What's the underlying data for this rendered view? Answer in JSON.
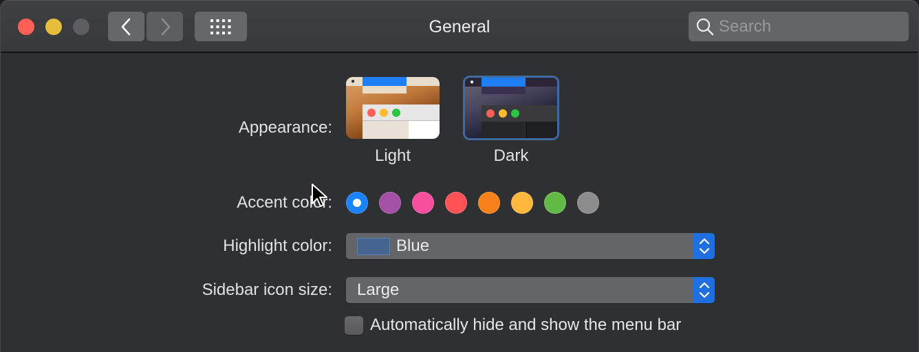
{
  "window": {
    "title": "General",
    "traffic_lights": {
      "close_color": "#fe5f57",
      "minimize_color": "#e5bf3c",
      "zoom_color": "#5e5e60"
    }
  },
  "toolbar": {
    "back_icon": "chevron-left-icon",
    "forward_icon": "chevron-right-icon",
    "grid_icon": "show-all-grid-icon",
    "search": {
      "placeholder": "Search",
      "value": "",
      "icon": "search-icon"
    }
  },
  "appearance": {
    "label": "Appearance:",
    "options": [
      {
        "label": "Light",
        "selected": false
      },
      {
        "label": "Dark",
        "selected": true
      }
    ]
  },
  "accent_color": {
    "label": "Accent color:",
    "options": [
      {
        "name": "Blue",
        "color": "#1a82fb",
        "selected": true
      },
      {
        "name": "Purple",
        "color": "#a550a7",
        "selected": false
      },
      {
        "name": "Pink",
        "color": "#f74f9e",
        "selected": false
      },
      {
        "name": "Red",
        "color": "#fe5257",
        "selected": false
      },
      {
        "name": "Orange",
        "color": "#f7821b",
        "selected": false
      },
      {
        "name": "Yellow",
        "color": "#ffb73d",
        "selected": false
      },
      {
        "name": "Green",
        "color": "#62ba46",
        "selected": false
      },
      {
        "name": "Graphite",
        "color": "#8c8c8c",
        "selected": false
      }
    ]
  },
  "highlight_color": {
    "label": "Highlight color:",
    "value": "Blue",
    "swatch_color": "#44658f"
  },
  "sidebar_icon_size": {
    "label": "Sidebar icon size:",
    "value": "Large"
  },
  "menu_bar": {
    "label": "Automatically hide and show the menu bar",
    "checked": false
  },
  "accent": "#1f6fe0"
}
